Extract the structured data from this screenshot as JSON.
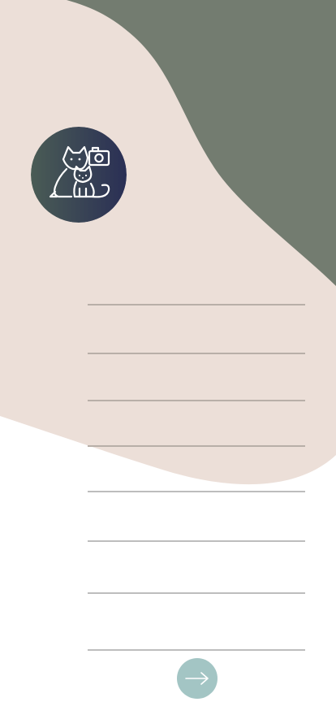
{
  "app": {
    "logo_icon": "pet-camera-icon",
    "colors": {
      "peach_blob": "#ecdfd8",
      "sage_blob": "#737c70",
      "logo_gradient_start": "#4a5c55",
      "logo_gradient_end": "#2a2f55",
      "underline_on_peach": "#b8afa8",
      "underline_on_white": "#bdbdbd",
      "next_button": "#a3c5c4"
    }
  },
  "form": {
    "fields": [
      {
        "value": "",
        "placeholder": ""
      },
      {
        "value": "",
        "placeholder": ""
      },
      {
        "value": "",
        "placeholder": ""
      },
      {
        "value": "",
        "placeholder": ""
      },
      {
        "value": "",
        "placeholder": ""
      },
      {
        "value": "",
        "placeholder": ""
      },
      {
        "value": "",
        "placeholder": ""
      },
      {
        "value": "",
        "placeholder": ""
      }
    ]
  },
  "actions": {
    "next_icon": "arrow-right-icon"
  }
}
